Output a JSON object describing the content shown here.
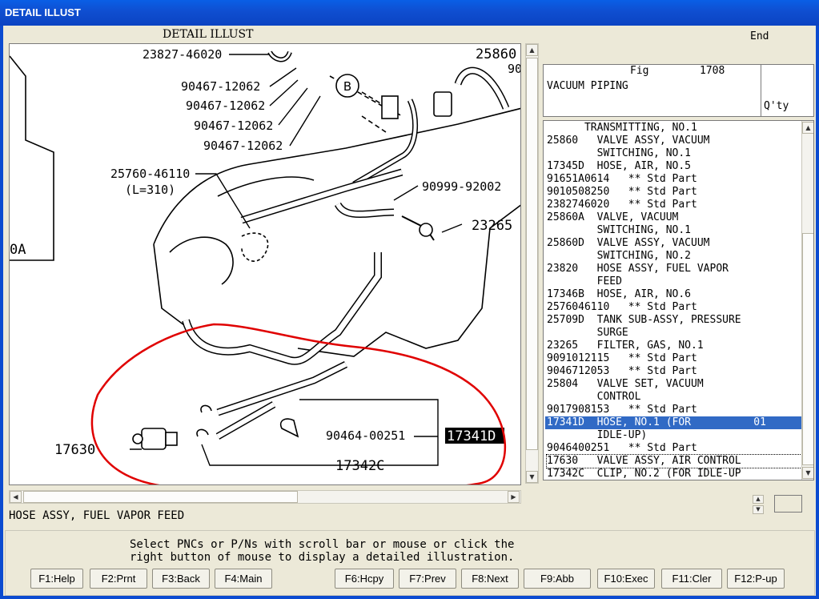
{
  "window": {
    "title": "DETAIL ILLUST"
  },
  "illustration": {
    "heading": "DETAIL ILLUST",
    "callouts": [
      "23827-46020",
      "90467-12062",
      "90467-12062",
      "90467-12062",
      "90467-12062",
      "25860",
      "90",
      "25760-46110",
      "(L=310)",
      "90999-92002",
      "23265",
      "0A",
      "17630",
      "90464-00251",
      "17341D",
      "17342C"
    ],
    "circle_label": "B"
  },
  "right_panel": {
    "end_label": "End",
    "fig_label": "Fig",
    "fig_number": "1708",
    "fig_title": "VACUUM PIPING",
    "qty_header": "Q'ty",
    "rows": [
      "      TRANSMITTING, NO.1",
      "25860   VALVE ASSY, VACUUM",
      "        SWITCHING, NO.1",
      "17345D  HOSE, AIR, NO.5",
      "91651A0614   ** Std Part",
      "9010508250   ** Std Part",
      "2382746020   ** Std Part",
      "25860A  VALVE, VACUUM",
      "        SWITCHING, NO.1",
      "25860D  VALVE ASSY, VACUUM",
      "        SWITCHING, NO.2",
      "23820   HOSE ASSY, FUEL VAPOR",
      "        FEED",
      "17346B  HOSE, AIR, NO.6",
      "2576046110   ** Std Part",
      "25709D  TANK SUB-ASSY, PRESSURE",
      "        SURGE",
      "23265   FILTER, GAS, NO.1",
      "9091012115   ** Std Part",
      "9046712053   ** Std Part",
      "25804   VALVE SET, VACUUM",
      "        CONTROL",
      "9017908153   ** Std Part",
      "17341D  HOSE, NO.1 (FOR          01",
      "        IDLE-UP)",
      "9046400251   ** Std Part",
      "17630   VALVE ASSY, AIR CONTROL",
      "17342C  CLIP, NO.2 (FOR IDLE-UP"
    ],
    "selected_index": 23,
    "focused_index": 26
  },
  "status_text": "HOSE ASSY, FUEL VAPOR FEED",
  "message": {
    "line1": "Select PNCs or P/Ns with scroll bar or mouse or click the",
    "line2": "right button of mouse to display a detailed illustration."
  },
  "function_keys": [
    "F1:Help",
    "F2:Prnt",
    "F3:Back",
    "F4:Main",
    "F6:Hcpy",
    "F7:Prev",
    "F8:Next",
    "F9:Abb",
    "F10:Exec",
    "F11:Cler",
    "F12:P-up"
  ],
  "colors": {
    "title_bar": "#0b4bd0",
    "selection": "#316ac5",
    "annotation": "#e00000"
  }
}
